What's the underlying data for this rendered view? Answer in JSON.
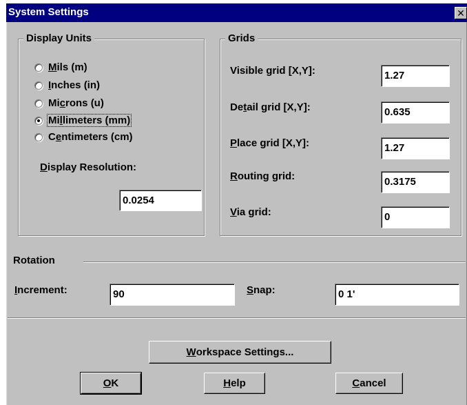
{
  "window": {
    "title": "System Settings",
    "close_glyph": "✕"
  },
  "display_units": {
    "title": "Display Units",
    "options": [
      {
        "pre": "",
        "key": "M",
        "post": "ils (m)",
        "checked": false
      },
      {
        "pre": "",
        "key": "I",
        "post": "nches (in)",
        "checked": false
      },
      {
        "pre": "Mi",
        "key": "c",
        "post": "rons (u)",
        "checked": false
      },
      {
        "pre": "Mi",
        "key": "l",
        "post": "limeters (mm)",
        "checked": true
      },
      {
        "pre": "C",
        "key": "e",
        "post": "ntimeters (cm)",
        "checked": false
      }
    ],
    "resolution_label": {
      "pre": "",
      "key": "D",
      "post": "isplay Resolution:"
    },
    "resolution_value": "0.0254"
  },
  "grids": {
    "title": "Grids",
    "visible": {
      "pre": "Visible grid [X,Y]:",
      "key": "",
      "post": "",
      "value": "1.27"
    },
    "detail": {
      "pre": "De",
      "key": "t",
      "post": "ail grid [X,Y]:",
      "value": "0.635"
    },
    "place": {
      "pre": "",
      "key": "P",
      "post": "lace grid [X,Y]:",
      "value": "1.27"
    },
    "routing": {
      "pre": "",
      "key": "R",
      "post": "outing grid:",
      "value": "0.3175"
    },
    "via": {
      "pre": "",
      "key": "V",
      "post": "ia grid:",
      "value": "0"
    }
  },
  "rotation": {
    "title": "Rotation",
    "increment": {
      "pre": "",
      "key": "I",
      "post": "ncrement:",
      "value": "90"
    },
    "snap": {
      "pre": "",
      "key": "S",
      "post": "nap:",
      "value": "0 1'"
    }
  },
  "buttons": {
    "workspace": {
      "pre": "",
      "key": "W",
      "post": "orkspace Settings..."
    },
    "ok": {
      "pre": "",
      "key": "O",
      "post": "K"
    },
    "help": {
      "pre": "",
      "key": "H",
      "post": "elp"
    },
    "cancel": {
      "pre": "",
      "key": "C",
      "post": "ancel"
    }
  },
  "colors": {
    "titlebar": "#000080",
    "face": "#c0c0c0",
    "field": "#ffffff"
  }
}
